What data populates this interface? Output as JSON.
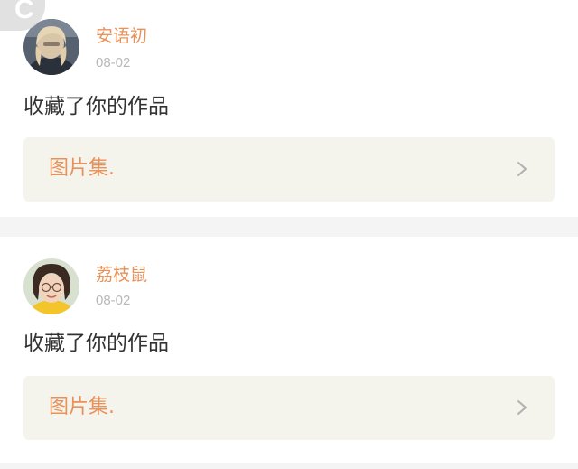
{
  "colors": {
    "accent": "#e8925a",
    "page_bg": "#f4f4f4",
    "work_box_bg": "#f4f3ec"
  },
  "watermark": {
    "letter": "C"
  },
  "notifications": [
    {
      "username": "安语初",
      "date": "08-02",
      "action": "收藏了你的作品",
      "work_title": "图片集.",
      "avatar_icon": "avatar-girl-blonde-hair",
      "chevron_icon": "chevron-right-icon"
    },
    {
      "username": "荔枝鼠",
      "date": "08-02",
      "action": "收藏了你的作品",
      "work_title": "图片集.",
      "avatar_icon": "avatar-girl-glasses",
      "chevron_icon": "chevron-right-icon"
    }
  ]
}
